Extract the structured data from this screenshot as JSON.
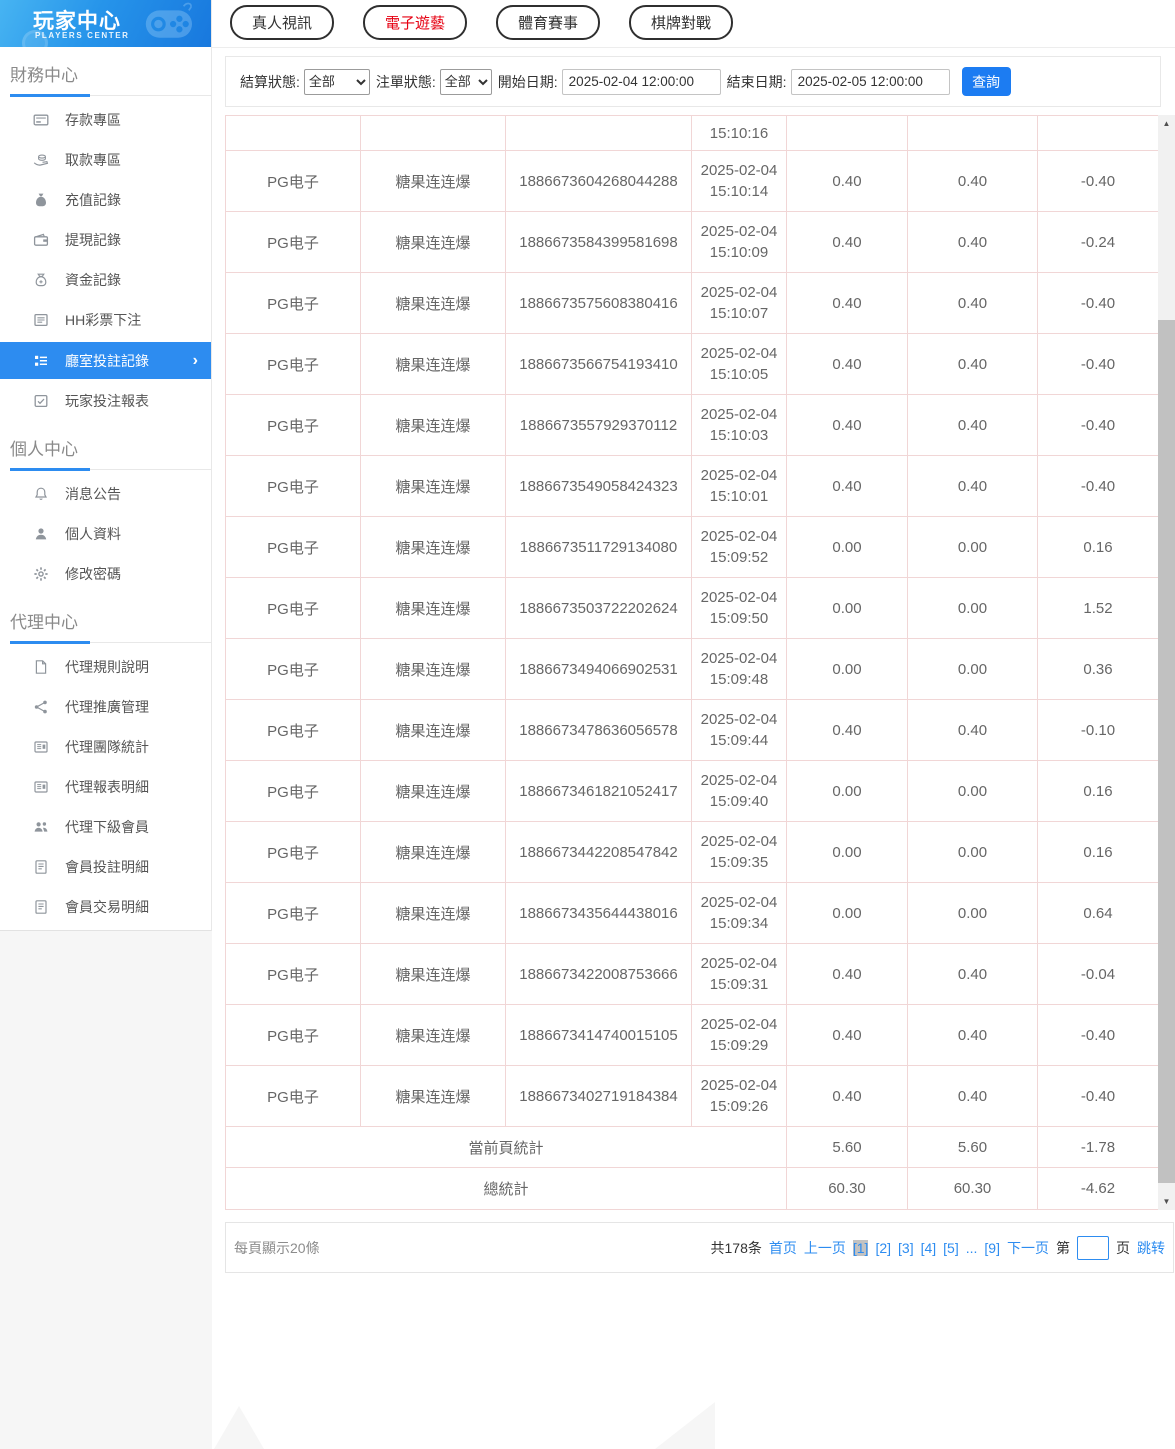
{
  "sidebar": {
    "logo": {
      "title": "玩家中心",
      "subtitle": "PLAYERS CENTER"
    },
    "sections": [
      {
        "heading": "財務中心",
        "items": [
          {
            "icon": "card",
            "label": "存款專區"
          },
          {
            "icon": "hand",
            "label": "取款專區"
          },
          {
            "icon": "moneybag",
            "label": "充值記錄"
          },
          {
            "icon": "wallet",
            "label": "提現記錄"
          },
          {
            "icon": "coinbag",
            "label": "資金記錄"
          },
          {
            "icon": "list",
            "label": "HH彩票下注"
          },
          {
            "icon": "menulist",
            "label": "廳室投註記錄",
            "active": true
          },
          {
            "icon": "report",
            "label": "玩家投注報表"
          }
        ]
      },
      {
        "heading": "個人中心",
        "items": [
          {
            "icon": "bell",
            "label": "消息公告"
          },
          {
            "icon": "user",
            "label": "個人資料"
          },
          {
            "icon": "gear",
            "label": "修改密碼"
          }
        ]
      },
      {
        "heading": "代理中心",
        "items": [
          {
            "icon": "doc",
            "label": "代理規則說明"
          },
          {
            "icon": "share",
            "label": "代理推廣管理"
          },
          {
            "icon": "news",
            "label": "代理團隊統計"
          },
          {
            "icon": "news",
            "label": "代理報表明細"
          },
          {
            "icon": "users",
            "label": "代理下級會員"
          },
          {
            "icon": "doclist",
            "label": "會員投註明細"
          },
          {
            "icon": "doclist",
            "label": "會員交易明細"
          }
        ]
      }
    ]
  },
  "tabs": [
    {
      "label": "真人視訊",
      "active": false
    },
    {
      "label": "電子遊藝",
      "active": true
    },
    {
      "label": "體育賽事",
      "active": false
    },
    {
      "label": "棋牌對戰",
      "active": false
    }
  ],
  "filters": {
    "settle_label": "結算狀態:",
    "settle_value": "全部",
    "order_label": "注單狀態:",
    "order_value": "全部",
    "start_label": "開始日期:",
    "start_value": "2025-02-04 12:00:00",
    "end_label": "結束日期:",
    "end_value": "2025-02-05 12:00:00",
    "search_label": "查詢"
  },
  "table": {
    "clipped_row_time": "15:10:16",
    "rows": [
      {
        "provider": "PG电子",
        "game": "糖果连连爆",
        "order": "1886673604268044288",
        "date": "2025-02-04",
        "time": "15:10:14",
        "bet": "0.40",
        "valid": "0.40",
        "profit": "-0.40"
      },
      {
        "provider": "PG电子",
        "game": "糖果连连爆",
        "order": "1886673584399581698",
        "date": "2025-02-04",
        "time": "15:10:09",
        "bet": "0.40",
        "valid": "0.40",
        "profit": "-0.24"
      },
      {
        "provider": "PG电子",
        "game": "糖果连连爆",
        "order": "1886673575608380416",
        "date": "2025-02-04",
        "time": "15:10:07",
        "bet": "0.40",
        "valid": "0.40",
        "profit": "-0.40"
      },
      {
        "provider": "PG电子",
        "game": "糖果连连爆",
        "order": "1886673566754193410",
        "date": "2025-02-04",
        "time": "15:10:05",
        "bet": "0.40",
        "valid": "0.40",
        "profit": "-0.40"
      },
      {
        "provider": "PG电子",
        "game": "糖果连连爆",
        "order": "1886673557929370112",
        "date": "2025-02-04",
        "time": "15:10:03",
        "bet": "0.40",
        "valid": "0.40",
        "profit": "-0.40"
      },
      {
        "provider": "PG电子",
        "game": "糖果连连爆",
        "order": "1886673549058424323",
        "date": "2025-02-04",
        "time": "15:10:01",
        "bet": "0.40",
        "valid": "0.40",
        "profit": "-0.40"
      },
      {
        "provider": "PG电子",
        "game": "糖果连连爆",
        "order": "1886673511729134080",
        "date": "2025-02-04",
        "time": "15:09:52",
        "bet": "0.00",
        "valid": "0.00",
        "profit": "0.16"
      },
      {
        "provider": "PG电子",
        "game": "糖果连连爆",
        "order": "1886673503722202624",
        "date": "2025-02-04",
        "time": "15:09:50",
        "bet": "0.00",
        "valid": "0.00",
        "profit": "1.52"
      },
      {
        "provider": "PG电子",
        "game": "糖果连连爆",
        "order": "1886673494066902531",
        "date": "2025-02-04",
        "time": "15:09:48",
        "bet": "0.00",
        "valid": "0.00",
        "profit": "0.36"
      },
      {
        "provider": "PG电子",
        "game": "糖果连连爆",
        "order": "1886673478636056578",
        "date": "2025-02-04",
        "time": "15:09:44",
        "bet": "0.40",
        "valid": "0.40",
        "profit": "-0.10"
      },
      {
        "provider": "PG电子",
        "game": "糖果连连爆",
        "order": "1886673461821052417",
        "date": "2025-02-04",
        "time": "15:09:40",
        "bet": "0.00",
        "valid": "0.00",
        "profit": "0.16"
      },
      {
        "provider": "PG电子",
        "game": "糖果连连爆",
        "order": "1886673442208547842",
        "date": "2025-02-04",
        "time": "15:09:35",
        "bet": "0.00",
        "valid": "0.00",
        "profit": "0.16"
      },
      {
        "provider": "PG电子",
        "game": "糖果连连爆",
        "order": "1886673435644438016",
        "date": "2025-02-04",
        "time": "15:09:34",
        "bet": "0.00",
        "valid": "0.00",
        "profit": "0.64"
      },
      {
        "provider": "PG电子",
        "game": "糖果连连爆",
        "order": "1886673422008753666",
        "date": "2025-02-04",
        "time": "15:09:31",
        "bet": "0.40",
        "valid": "0.40",
        "profit": "-0.04"
      },
      {
        "provider": "PG电子",
        "game": "糖果连连爆",
        "order": "1886673414740015105",
        "date": "2025-02-04",
        "time": "15:09:29",
        "bet": "0.40",
        "valid": "0.40",
        "profit": "-0.40"
      },
      {
        "provider": "PG电子",
        "game": "糖果连连爆",
        "order": "1886673402719184384",
        "date": "2025-02-04",
        "time": "15:09:26",
        "bet": "0.40",
        "valid": "0.40",
        "profit": "-0.40"
      }
    ],
    "page_summary": {
      "label": "當前頁統計",
      "bet": "5.60",
      "valid": "5.60",
      "profit": "-1.78"
    },
    "total_summary": {
      "label": "總統計",
      "bet": "60.30",
      "valid": "60.30",
      "profit": "-4.62"
    }
  },
  "pagination": {
    "per_page": "每頁顯示20條",
    "total": "共178条",
    "first": "首页",
    "prev": "上一页",
    "pages": [
      {
        "label": "[1]",
        "current": true
      },
      {
        "label": "[2]"
      },
      {
        "label": "[3]"
      },
      {
        "label": "[4]"
      },
      {
        "label": "[5]"
      },
      {
        "label": "..."
      },
      {
        "label": "[9]"
      }
    ],
    "next": "下一页",
    "jump_pre": "第",
    "jump_post": "页",
    "jump_go": "跳转"
  },
  "icons": {
    "chevron_right": "›",
    "scroll_up": "▲",
    "scroll_down": "▼"
  },
  "colors": {
    "accent_blue": "#2d8cf0",
    "tab_active_red": "#e60012",
    "search_button_blue": "#1c7cf2",
    "table_border_pink": "#f1d6d6",
    "header_gradient_start": "#47b4f2",
    "header_gradient_end": "#1878de"
  }
}
